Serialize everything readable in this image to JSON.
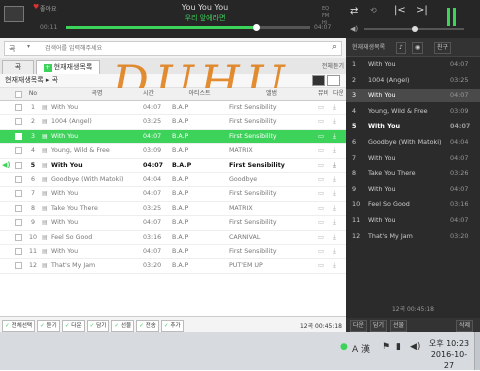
{
  "player": {
    "like_label": "좋아요",
    "song_title": "You You You",
    "subtitle": "우리 앞에라면",
    "elapsed": "00:11",
    "total": "04:07",
    "progress": 0.78,
    "eq_labels": [
      "EQ",
      "FM",
      "Hi"
    ]
  },
  "search": {
    "scope": "곡",
    "placeholder": "검색어를 입력해주세요"
  },
  "tabs": {
    "listen": "곡",
    "current": "현재재생목록",
    "all": "전체듣기"
  },
  "breadcrumb": "현재재생목록 ▸ 곡",
  "watermark": "DUHU",
  "table": {
    "headers": {
      "no": "No",
      "title": "곡명",
      "time": "시간",
      "artist": "아티스트",
      "album": "앨범",
      "mv": "뮤비",
      "dl": "다운"
    },
    "rows": [
      {
        "no": "1",
        "title": "With You",
        "time": "04:07",
        "artist": "B.A.P",
        "album": "First Sensibility",
        "selected": false,
        "bold": false
      },
      {
        "no": "2",
        "title": "1004 (Angel)",
        "time": "03:25",
        "artist": "B.A.P",
        "album": "First Sensibility",
        "selected": false,
        "bold": false
      },
      {
        "no": "3",
        "title": "With You",
        "time": "04:07",
        "artist": "B.A.P",
        "album": "First Sensibility",
        "selected": true,
        "bold": false
      },
      {
        "no": "4",
        "title": "Young, Wild & Free",
        "time": "03:09",
        "artist": "B.A.P",
        "album": "MATRIX",
        "selected": false,
        "bold": false
      },
      {
        "no": "5",
        "title": "With You",
        "time": "04:07",
        "artist": "B.A.P",
        "album": "First Sensibility",
        "selected": false,
        "bold": true
      },
      {
        "no": "6",
        "title": "Goodbye (With Matoki)",
        "time": "04:04",
        "artist": "B.A.P",
        "album": "Goodbye",
        "selected": false,
        "bold": false
      },
      {
        "no": "7",
        "title": "With You",
        "time": "04:07",
        "artist": "B.A.P",
        "album": "First Sensibility",
        "selected": false,
        "bold": false
      },
      {
        "no": "8",
        "title": "Take You There",
        "time": "03:25",
        "artist": "B.A.P",
        "album": "MATRIX",
        "selected": false,
        "bold": false
      },
      {
        "no": "9",
        "title": "With You",
        "time": "04:07",
        "artist": "B.A.P",
        "album": "First Sensibility",
        "selected": false,
        "bold": false
      },
      {
        "no": "10",
        "title": "Feel So Good",
        "time": "03:16",
        "artist": "B.A.P",
        "album": "CARNIVAL",
        "selected": false,
        "bold": false
      },
      {
        "no": "11",
        "title": "With You",
        "time": "04:07",
        "artist": "B.A.P",
        "album": "First Sensibility",
        "selected": false,
        "bold": false
      },
      {
        "no": "12",
        "title": "That's My Jam",
        "time": "03:20",
        "artist": "B.A.P",
        "album": "PUT'EM UP",
        "selected": false,
        "bold": false
      }
    ]
  },
  "bottom": {
    "buttons": [
      "전체선택",
      "듣기",
      "다운",
      "담기",
      "선물",
      "전송",
      "추가"
    ],
    "count": "12곡 00:45:18"
  },
  "right_panel": {
    "head_label": "현재재생목록",
    "head_buttons": [
      "친구"
    ],
    "rows": [
      {
        "no": "1",
        "title": "With You",
        "time": "04:07",
        "selected": false,
        "bold": false
      },
      {
        "no": "2",
        "title": "1004 (Angel)",
        "time": "03:25",
        "selected": false,
        "bold": false
      },
      {
        "no": "3",
        "title": "With You",
        "time": "04:07",
        "selected": true,
        "bold": false
      },
      {
        "no": "4",
        "title": "Young, Wild & Free",
        "time": "03:09",
        "selected": false,
        "bold": false
      },
      {
        "no": "5",
        "title": "With You",
        "time": "04:07",
        "selected": false,
        "bold": true
      },
      {
        "no": "6",
        "title": "Goodbye (With Matoki)",
        "time": "04:04",
        "selected": false,
        "bold": false
      },
      {
        "no": "7",
        "title": "With You",
        "time": "04:07",
        "selected": false,
        "bold": false
      },
      {
        "no": "8",
        "title": "Take You There",
        "time": "03:26",
        "selected": false,
        "bold": false
      },
      {
        "no": "9",
        "title": "With You",
        "time": "04:07",
        "selected": false,
        "bold": false
      },
      {
        "no": "10",
        "title": "Feel So Good",
        "time": "03:16",
        "selected": false,
        "bold": false
      },
      {
        "no": "11",
        "title": "With You",
        "time": "04:07",
        "selected": false,
        "bold": false
      },
      {
        "no": "12",
        "title": "That's My Jam",
        "time": "03:20",
        "selected": false,
        "bold": false
      }
    ],
    "total": "12곡 00:45:18",
    "foot_buttons": [
      "다운",
      "담기",
      "선물",
      "삭제"
    ]
  },
  "taskbar": {
    "ampm_time": "오후 10:23",
    "date": "2016-10-27",
    "ime": "A 漢"
  },
  "colors": {
    "accent": "#3dd35b",
    "dark": "#262626"
  }
}
